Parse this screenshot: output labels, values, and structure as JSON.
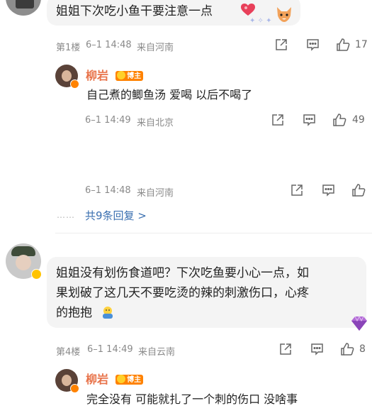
{
  "comment1": {
    "text": "姐姐下次吃小鱼干要注意一点",
    "floor": "第1楼",
    "time": "6–1 14:48",
    "location": "来自河南",
    "likes": "17"
  },
  "reply1": {
    "author": "柳岩",
    "badge": "博主",
    "text": "自己煮的鲫鱼汤 爱喝 以后不喝了",
    "time": "6–1 14:49",
    "location": "来自北京",
    "likes": "49"
  },
  "reply2": {
    "time": "6–1 14:48",
    "location": "来自河南"
  },
  "more_replies": {
    "dots": "……",
    "label": "共9条回复 >"
  },
  "comment2": {
    "text_line1": "姐姐没有划伤食道吧？下次吃鱼要小心一点，如",
    "text_line2": "果划破了这几天不要吃烫的辣的刺激伤口，心疼",
    "text_line3": "的抱抱",
    "floor": "第4楼",
    "time": "6–1 14:49",
    "location": "来自云南",
    "likes": "8"
  },
  "reply3": {
    "author": "柳岩",
    "badge": "博主",
    "text": "完全没有 可能就扎了一个刺的伤口 没啥事"
  },
  "colors": {
    "author": "#e8734a",
    "link": "#3a6fb0",
    "badge": "#ff8200",
    "bubble": "#f4f4f4"
  }
}
